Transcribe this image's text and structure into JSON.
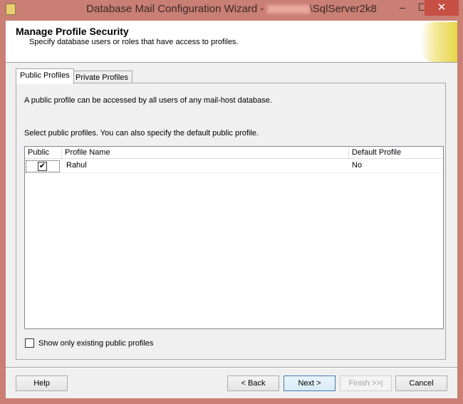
{
  "window": {
    "title_prefix": "Database Mail Configuration Wizard - ",
    "title_suffix": "\\SqlServer2k8",
    "minimize": "–",
    "maximize": "☐",
    "close": "✕"
  },
  "header": {
    "title": "Manage Profile Security",
    "subtitle": "Specify database users or roles that have access to profiles."
  },
  "tabs": [
    {
      "label": "Public Profiles",
      "active": true
    },
    {
      "label": "Private Profiles",
      "active": false
    }
  ],
  "panel": {
    "description": "A public profile can be accessed by all users of any mail-host database.",
    "instruction": "Select public profiles. You can also specify the default public profile."
  },
  "grid": {
    "columns": [
      "Public",
      "Profile Name",
      "Default Profile"
    ],
    "rows": [
      {
        "public": true,
        "public_mark": "✔",
        "profile_name": "Rahul",
        "default_profile": "No"
      }
    ]
  },
  "show_existing": {
    "label": "Show only existing public profiles",
    "checked": false
  },
  "buttons": {
    "help": "Help",
    "back": "< Back",
    "next": "Next >",
    "finish": "Finish >>|",
    "cancel": "Cancel"
  }
}
